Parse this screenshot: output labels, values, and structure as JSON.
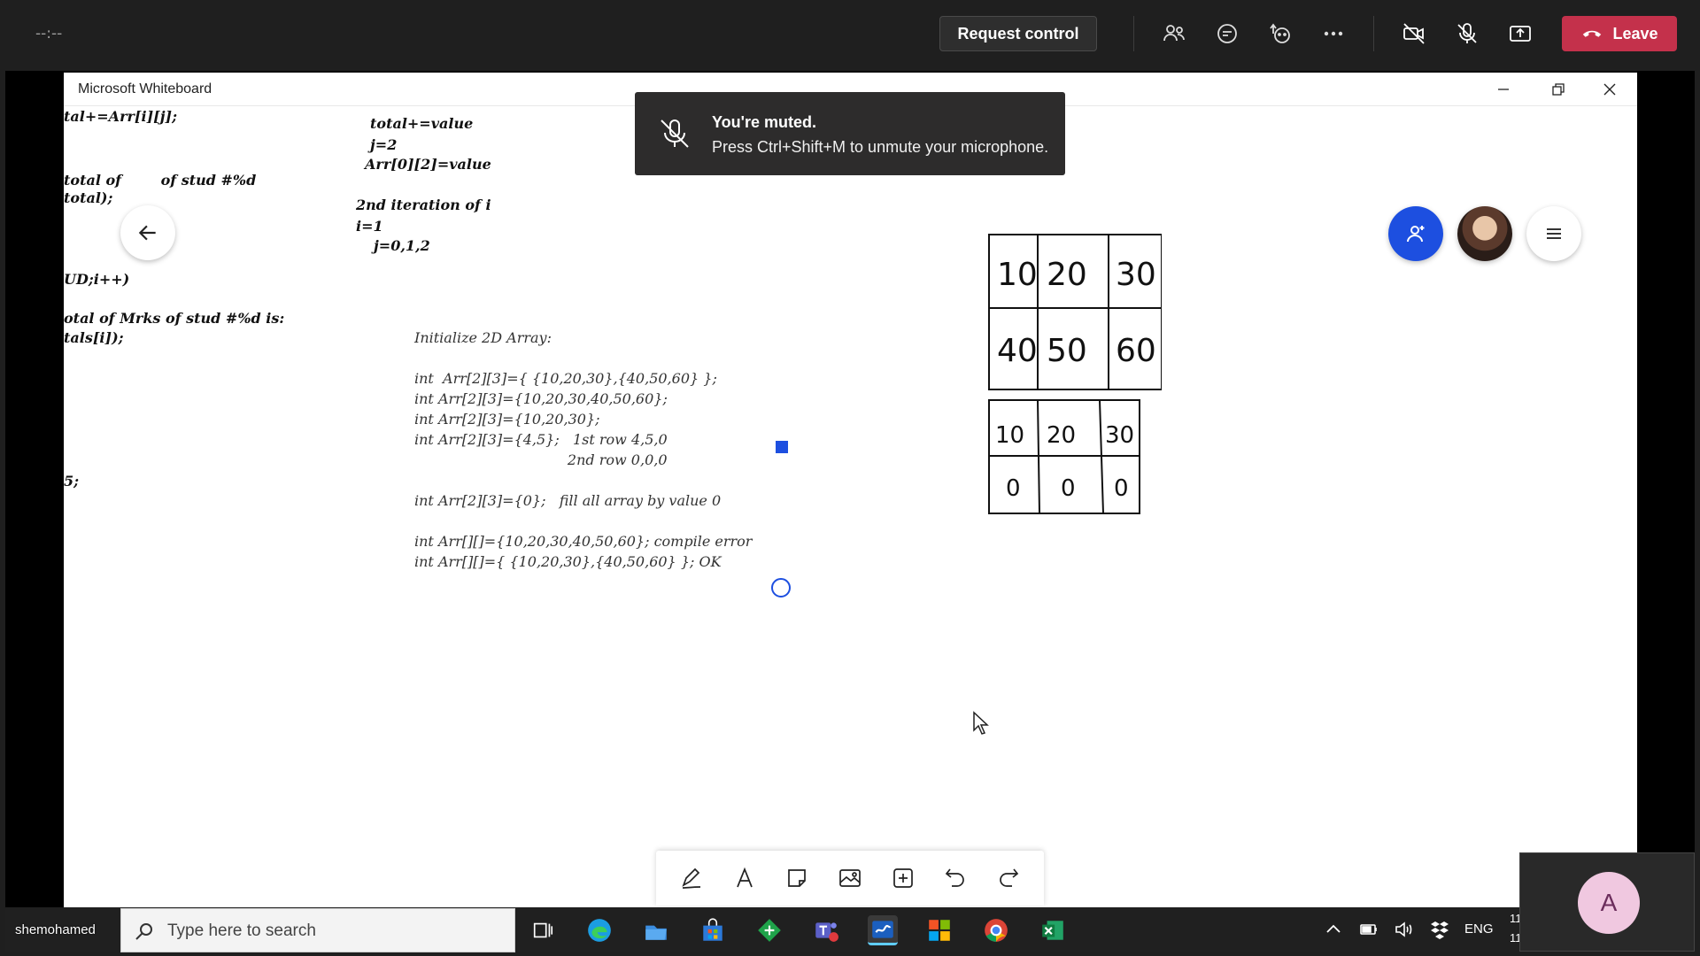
{
  "teams": {
    "call_timer": "--:--",
    "request_control_label": "Request control",
    "leave_label": "Leave",
    "icons": [
      "people-icon",
      "chat-icon",
      "react-icon",
      "more-icon",
      "camera-off-icon",
      "mic-off-icon",
      "share-icon"
    ]
  },
  "whiteboard": {
    "window_title": "Microsoft Whiteboard",
    "left_code": [
      "tal+=Arr[i][j];",
      "total of        of stud #%d",
      "total);",
      "UD;i++)",
      "otal of Mrks of stud #%d is:",
      "tals[i]);",
      "5;"
    ],
    "iteration_notes": [
      "total+=value",
      "j=2",
      "Arr[0][2]=value",
      "2nd iteration of i",
      "i=1",
      "j=0,1,2"
    ],
    "init_title": "Initialize 2D Array:",
    "init_lines": [
      "int  Arr[2][3]={ {10,20,30},{40,50,60} };",
      "int Arr[2][3]={10,20,30,40,50,60};",
      "int Arr[2][3]={10,20,30};",
      "int Arr[2][3]={4,5};   1st row 4,5,0",
      "                                  2nd row 0,0,0",
      "int Arr[2][3]={0};   fill all array by value 0",
      "int Arr[][]={10,20,30,40,50,60}; compile error",
      "int Arr[][]={ {10,20,30},{40,50,60} }; OK"
    ],
    "grid_top": [
      [
        "10",
        "20",
        "30"
      ],
      [
        "40",
        "50",
        "60"
      ]
    ],
    "grid_bottom": [
      [
        "10",
        "20",
        "30"
      ],
      [
        "0",
        "0",
        "0"
      ]
    ],
    "tools": [
      "pen-icon",
      "text-icon",
      "note-icon",
      "image-icon",
      "add-icon",
      "undo-icon",
      "redo-icon"
    ]
  },
  "toast": {
    "title": "You're muted.",
    "message": "Press Ctrl+Shift+M to unmute your microphone."
  },
  "taskbar": {
    "user_label": "shemohamed",
    "search_placeholder": "Type here to search",
    "lang": "ENG",
    "clock_line1": "11",
    "clock_line2": "11"
  },
  "participant": {
    "initial": "A",
    "color": "#f0c8e0"
  },
  "colors": {
    "leave": "#c4314b",
    "invite": "#1d4fe0",
    "topbar": "#1f1f1f"
  }
}
